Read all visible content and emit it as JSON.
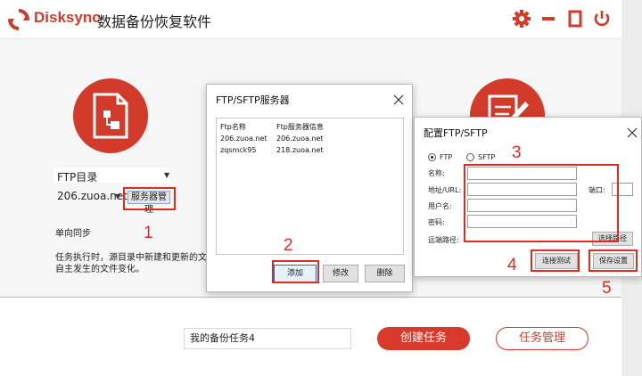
{
  "app": {
    "brand": "Disksync",
    "title": "数据备份恢复软件"
  },
  "colors": {
    "accent": "#d23a2a",
    "annotation": "#e32a1f"
  },
  "main": {
    "ftp_dir_label": "FTP目录",
    "server_value": "206.zuoa.net",
    "server_manage_button": "服务器管理",
    "sync_mode": "单向同步",
    "desc_line1": "任务执行时，源目录中新建和更新的文",
    "desc_line2": "自主发生的文件变化。"
  },
  "bottom": {
    "task_name": "我的备份任务4",
    "create_button": "创建任务",
    "manage_button": "任务管理"
  },
  "ftp_dialog": {
    "title": "FTP/SFTP服务器",
    "columns": [
      "Ftp名称",
      "Ftp服务器信息"
    ],
    "rows": [
      [
        "206.zuoa.net",
        "206.zuoa.net"
      ],
      [
        "zqsmck95",
        "218.zuoa.net"
      ]
    ],
    "add_button": "添加",
    "edit_button": "修改",
    "delete_button": "删除"
  },
  "config_dialog": {
    "title": "配置FTP/SFTP",
    "radio_ftp": "FTP",
    "radio_sftp": "SFTP",
    "name_label": "名称:",
    "address_label": "地址/URL:",
    "port_label": "端口:",
    "user_label": "用户名:",
    "password_label": "密码:",
    "remote_path_label": "远端路径:",
    "choose_path_button": "选择路径",
    "test_button": "连接测试",
    "save_button": "保存设置"
  },
  "annotations": [
    "1",
    "2",
    "3",
    "4",
    "5"
  ]
}
